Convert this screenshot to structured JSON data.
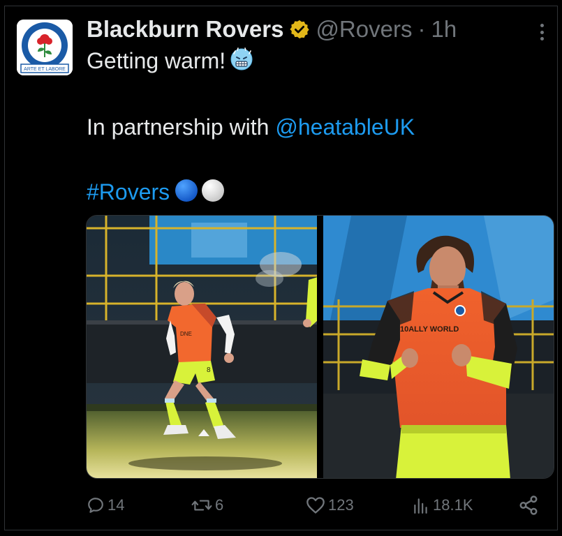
{
  "tweet": {
    "author_name": "Blackburn Rovers",
    "handle": "@Rovers",
    "separator": "·",
    "time": "1h",
    "line1": "Getting warm!",
    "line2_prefix": "In partnership with ",
    "line2_mention": "@heatableUK",
    "hashtag": "#Rovers",
    "emojis": [
      "cold-face",
      "blue-circle",
      "white-circle"
    ]
  },
  "avatar": {
    "logo_text_top": "BLACKBURN ROVERS F.C.",
    "motto": "ARTE ET LABORE"
  },
  "media": {
    "left_shirt_sponsor": "DNE",
    "right_shirt_sponsor": "10ALLY WORLD",
    "right_shorts_number": "8"
  },
  "actions": {
    "replies": "14",
    "reposts": "6",
    "likes": "123",
    "views": "18.1K"
  },
  "colors": {
    "background": "#000000",
    "text": "#e7e9ea",
    "muted": "#71767b",
    "link": "#1d9bf0",
    "verified": "#e2b719",
    "kit_orange": "#f2682e",
    "kit_yellow": "#d8f23a"
  }
}
